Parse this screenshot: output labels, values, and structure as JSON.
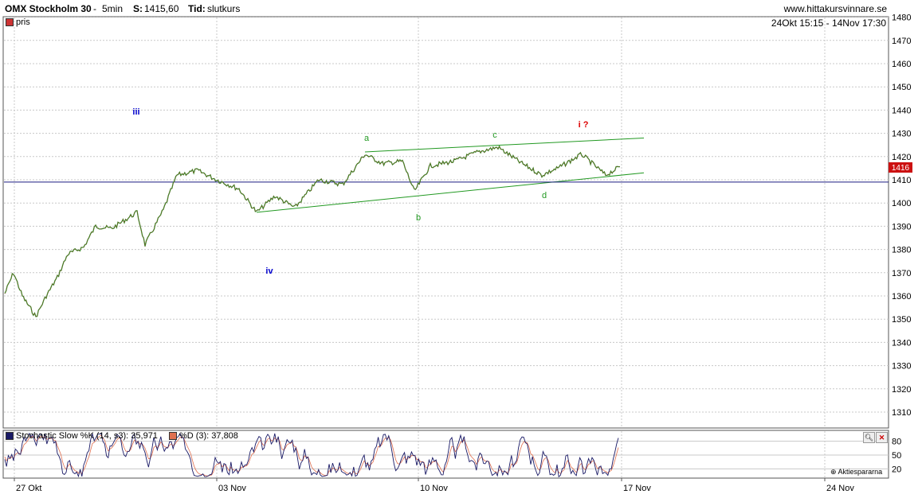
{
  "header": {
    "instrument": "OMX Stockholm 30",
    "interval": "5min",
    "sep": "-",
    "last_label": "S:",
    "last_value": "1415,60",
    "time_label": "Tid:",
    "time_value": "slutkurs",
    "site": "www.hittakursvinnare.se",
    "range": "24Okt 15:15 - 14Nov 17:30"
  },
  "legend": {
    "price": "pris",
    "price_color": "#cc3333",
    "stoch_k": "Stochastic Slow %K (14, s3): 35,971",
    "stoch_d": "%D (3): 37,808",
    "stoch_k_color": "#1a1a66",
    "stoch_d_color": "#e07050"
  },
  "watermark": "Aktiespararna",
  "annotations": [
    {
      "text": "iii",
      "color": "#0000cc"
    },
    {
      "text": "iv",
      "color": "#0000cc"
    },
    {
      "text": "a",
      "color": "#229922"
    },
    {
      "text": "b",
      "color": "#229922"
    },
    {
      "text": "c",
      "color": "#229922"
    },
    {
      "text": "d",
      "color": "#229922"
    },
    {
      "text": "i ?",
      "color": "#dd0000"
    }
  ],
  "chart_data": {
    "type": "line",
    "title": "OMX Stockholm 30",
    "x_ticks": [
      "27 Okt",
      "03 Nov",
      "10 Nov",
      "17 Nov",
      "24 Nov"
    ],
    "y_ticks": [
      1310,
      1320,
      1330,
      1340,
      1350,
      1360,
      1370,
      1380,
      1390,
      1400,
      1410,
      1420,
      1430,
      1440,
      1450,
      1460,
      1470,
      1480
    ],
    "ylim": [
      1303,
      1482
    ],
    "last_price_label": "1416",
    "reference_line": 1409,
    "series": [
      {
        "name": "pris",
        "x": [
          "24 Okt 15:15",
          "27 Okt",
          "27 Okt",
          "28 Okt",
          "28 Okt",
          "28 Okt",
          "29 Okt",
          "29 Okt",
          "30 Okt",
          "30 Okt",
          "30 Okt",
          "31 Okt",
          "31 Okt",
          "31 Okt",
          "31 Okt",
          "03 Nov",
          "03 Nov",
          "04 Nov",
          "04 Nov",
          "05 Nov",
          "05 Nov",
          "06 Nov",
          "06 Nov",
          "07 Nov",
          "07 Nov",
          "10 Nov",
          "10 Nov",
          "11 Nov",
          "11 Nov",
          "12 Nov",
          "12 Nov",
          "13 Nov",
          "13 Nov",
          "14 Nov",
          "14 Nov",
          "14 Nov 17:30"
        ],
        "values": [
          1361,
          1370,
          1360,
          1351,
          1360,
          1368,
          1378,
          1381,
          1390,
          1389,
          1396,
          1382,
          1397,
          1412,
          1414,
          1410,
          1406,
          1396,
          1403,
          1398,
          1410,
          1408,
          1421,
          1417,
          1418,
          1405,
          1416,
          1418,
          1422,
          1424,
          1417,
          1412,
          1415,
          1421,
          1412,
          1415.6
        ]
      }
    ],
    "trendlines": [
      {
        "name": "upper",
        "from": [
          "07 Nov",
          1422
        ],
        "to": [
          "17 Nov",
          1428
        ]
      },
      {
        "name": "lower",
        "from": [
          "04 Nov",
          1396
        ],
        "to": [
          "17 Nov",
          1413
        ]
      }
    ],
    "stochastic": {
      "ylim": [
        0,
        100
      ],
      "y_ticks": [
        20,
        50,
        80
      ],
      "k_last": 35.971,
      "d_last": 37.808
    }
  }
}
